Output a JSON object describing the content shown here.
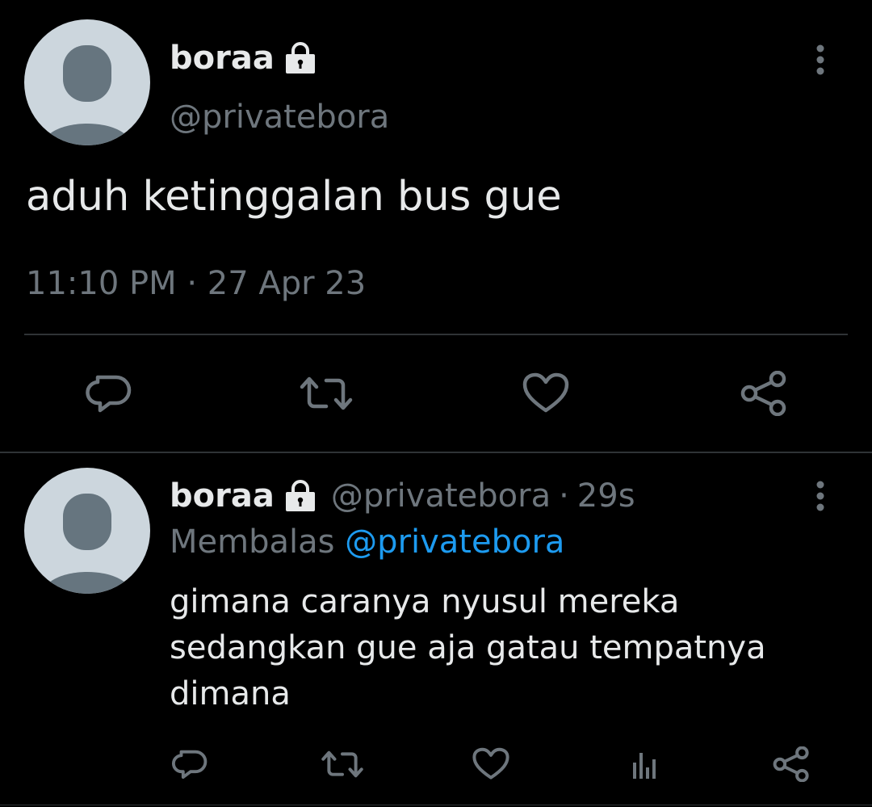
{
  "main_tweet": {
    "display_name": "boraa",
    "handle": "@privatebora",
    "text": "aduh ketinggalan bus gue",
    "timestamp": "11:10 PM · 27 Apr 23",
    "icons": [
      "lock-icon",
      "more-icon",
      "reply-icon",
      "retweet-icon",
      "like-icon",
      "share-icon"
    ]
  },
  "reply_tweet": {
    "display_name": "boraa",
    "handle": "@privatebora",
    "separator": "·",
    "time_ago": "29s",
    "replying_label": "Membalas",
    "replying_to": "@privatebora",
    "text_lines": [
      "gimana caranya nyusul mereka",
      "sedangkan gue aja gatau tempatnya",
      "dimana"
    ],
    "icons": [
      "lock-icon",
      "more-icon",
      "reply-icon",
      "retweet-icon",
      "like-icon",
      "analytics-icon",
      "share-icon"
    ]
  },
  "colors": {
    "background": "#000000",
    "text": "#e7e9ea",
    "muted": "#6e767d",
    "link": "#1d9bf0",
    "divider": "#2f3336",
    "avatar_bg": "#ccd6dd",
    "avatar_fg": "#66757f"
  }
}
